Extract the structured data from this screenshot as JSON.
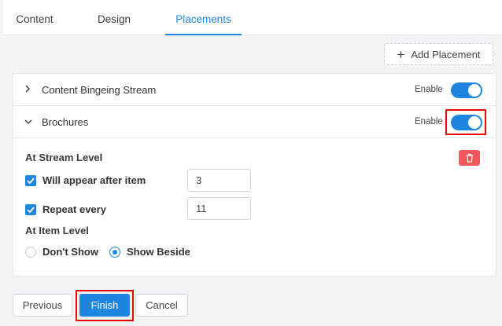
{
  "tabs": [
    {
      "label": "Content"
    },
    {
      "label": "Design"
    },
    {
      "label": "Placements"
    }
  ],
  "active_tab": "Placements",
  "add_placement_label": "Add Placement",
  "placements": [
    {
      "title": "Content Bingeing Stream",
      "enable_label": "Enable",
      "enabled": true,
      "expanded": false
    },
    {
      "title": "Brochures",
      "enable_label": "Enable",
      "enabled": true,
      "expanded": true
    }
  ],
  "stream_level": {
    "label": "At Stream Level",
    "appear_after": {
      "label": "Will appear after item",
      "checked": true,
      "value": "3"
    },
    "repeat_every": {
      "label": "Repeat every",
      "checked": true,
      "value": "11"
    }
  },
  "item_level": {
    "label": "At Item Level",
    "options": [
      {
        "label": "Don't Show",
        "selected": false
      },
      {
        "label": "Show Beside",
        "selected": true
      }
    ]
  },
  "footer": {
    "previous_label": "Previous",
    "finish_label": "Finish",
    "cancel_label": "Cancel"
  },
  "colors": {
    "accent": "#1f86e0",
    "danger": "#f0575d",
    "highlight": "#e00000"
  }
}
